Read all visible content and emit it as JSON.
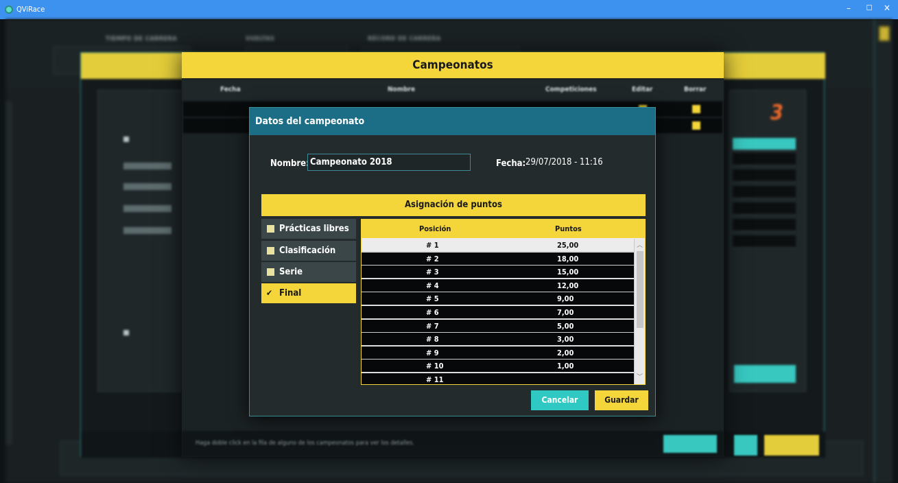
{
  "window": {
    "title": "QViRace",
    "controls": {
      "minimize": "–",
      "maximize": "☐",
      "close": "✕"
    }
  },
  "background": {
    "header_labels": [
      "TIEMPO DE CARRERA",
      "VUELTAS",
      "RÉCORD DE CARRERA"
    ]
  },
  "campeonatos": {
    "title": "Campeonatos",
    "columns": [
      "Fecha",
      "Nombre",
      "Competiciones",
      "Editar",
      "Borrar"
    ],
    "hint": "Haga doble click en la fila de alguno de los campeonatos para ver los detalles."
  },
  "datos": {
    "title": "Datos del campeonato",
    "nombre_label": "Nombre:",
    "nombre_value": "Campeonato 2018",
    "fecha_label": "Fecha:",
    "fecha_value": "29/07/2018 - 11:16",
    "asignacion_label": "Asignación de puntos",
    "categories": [
      {
        "label": "Prácticas libres",
        "selected": false
      },
      {
        "label": "Clasificación",
        "selected": false
      },
      {
        "label": "Serie",
        "selected": false
      },
      {
        "label": "Final",
        "selected": true
      }
    ],
    "table": {
      "col_posicion": "Posición",
      "col_puntos": "Puntos",
      "rows": [
        {
          "pos": "# 1",
          "pts": "25,00"
        },
        {
          "pos": "# 2",
          "pts": "18,00"
        },
        {
          "pos": "# 3",
          "pts": "15,00"
        },
        {
          "pos": "# 4",
          "pts": "12,00"
        },
        {
          "pos": "# 5",
          "pts": "9,00"
        },
        {
          "pos": "# 6",
          "pts": "7,00"
        },
        {
          "pos": "# 7",
          "pts": "5,00"
        },
        {
          "pos": "# 8",
          "pts": "3,00"
        },
        {
          "pos": "# 9",
          "pts": "2,00"
        },
        {
          "pos": "# 10",
          "pts": "1,00"
        },
        {
          "pos": "# 11",
          "pts": ""
        }
      ]
    },
    "cancel_label": "Cancelar",
    "save_label": "Guardar"
  }
}
